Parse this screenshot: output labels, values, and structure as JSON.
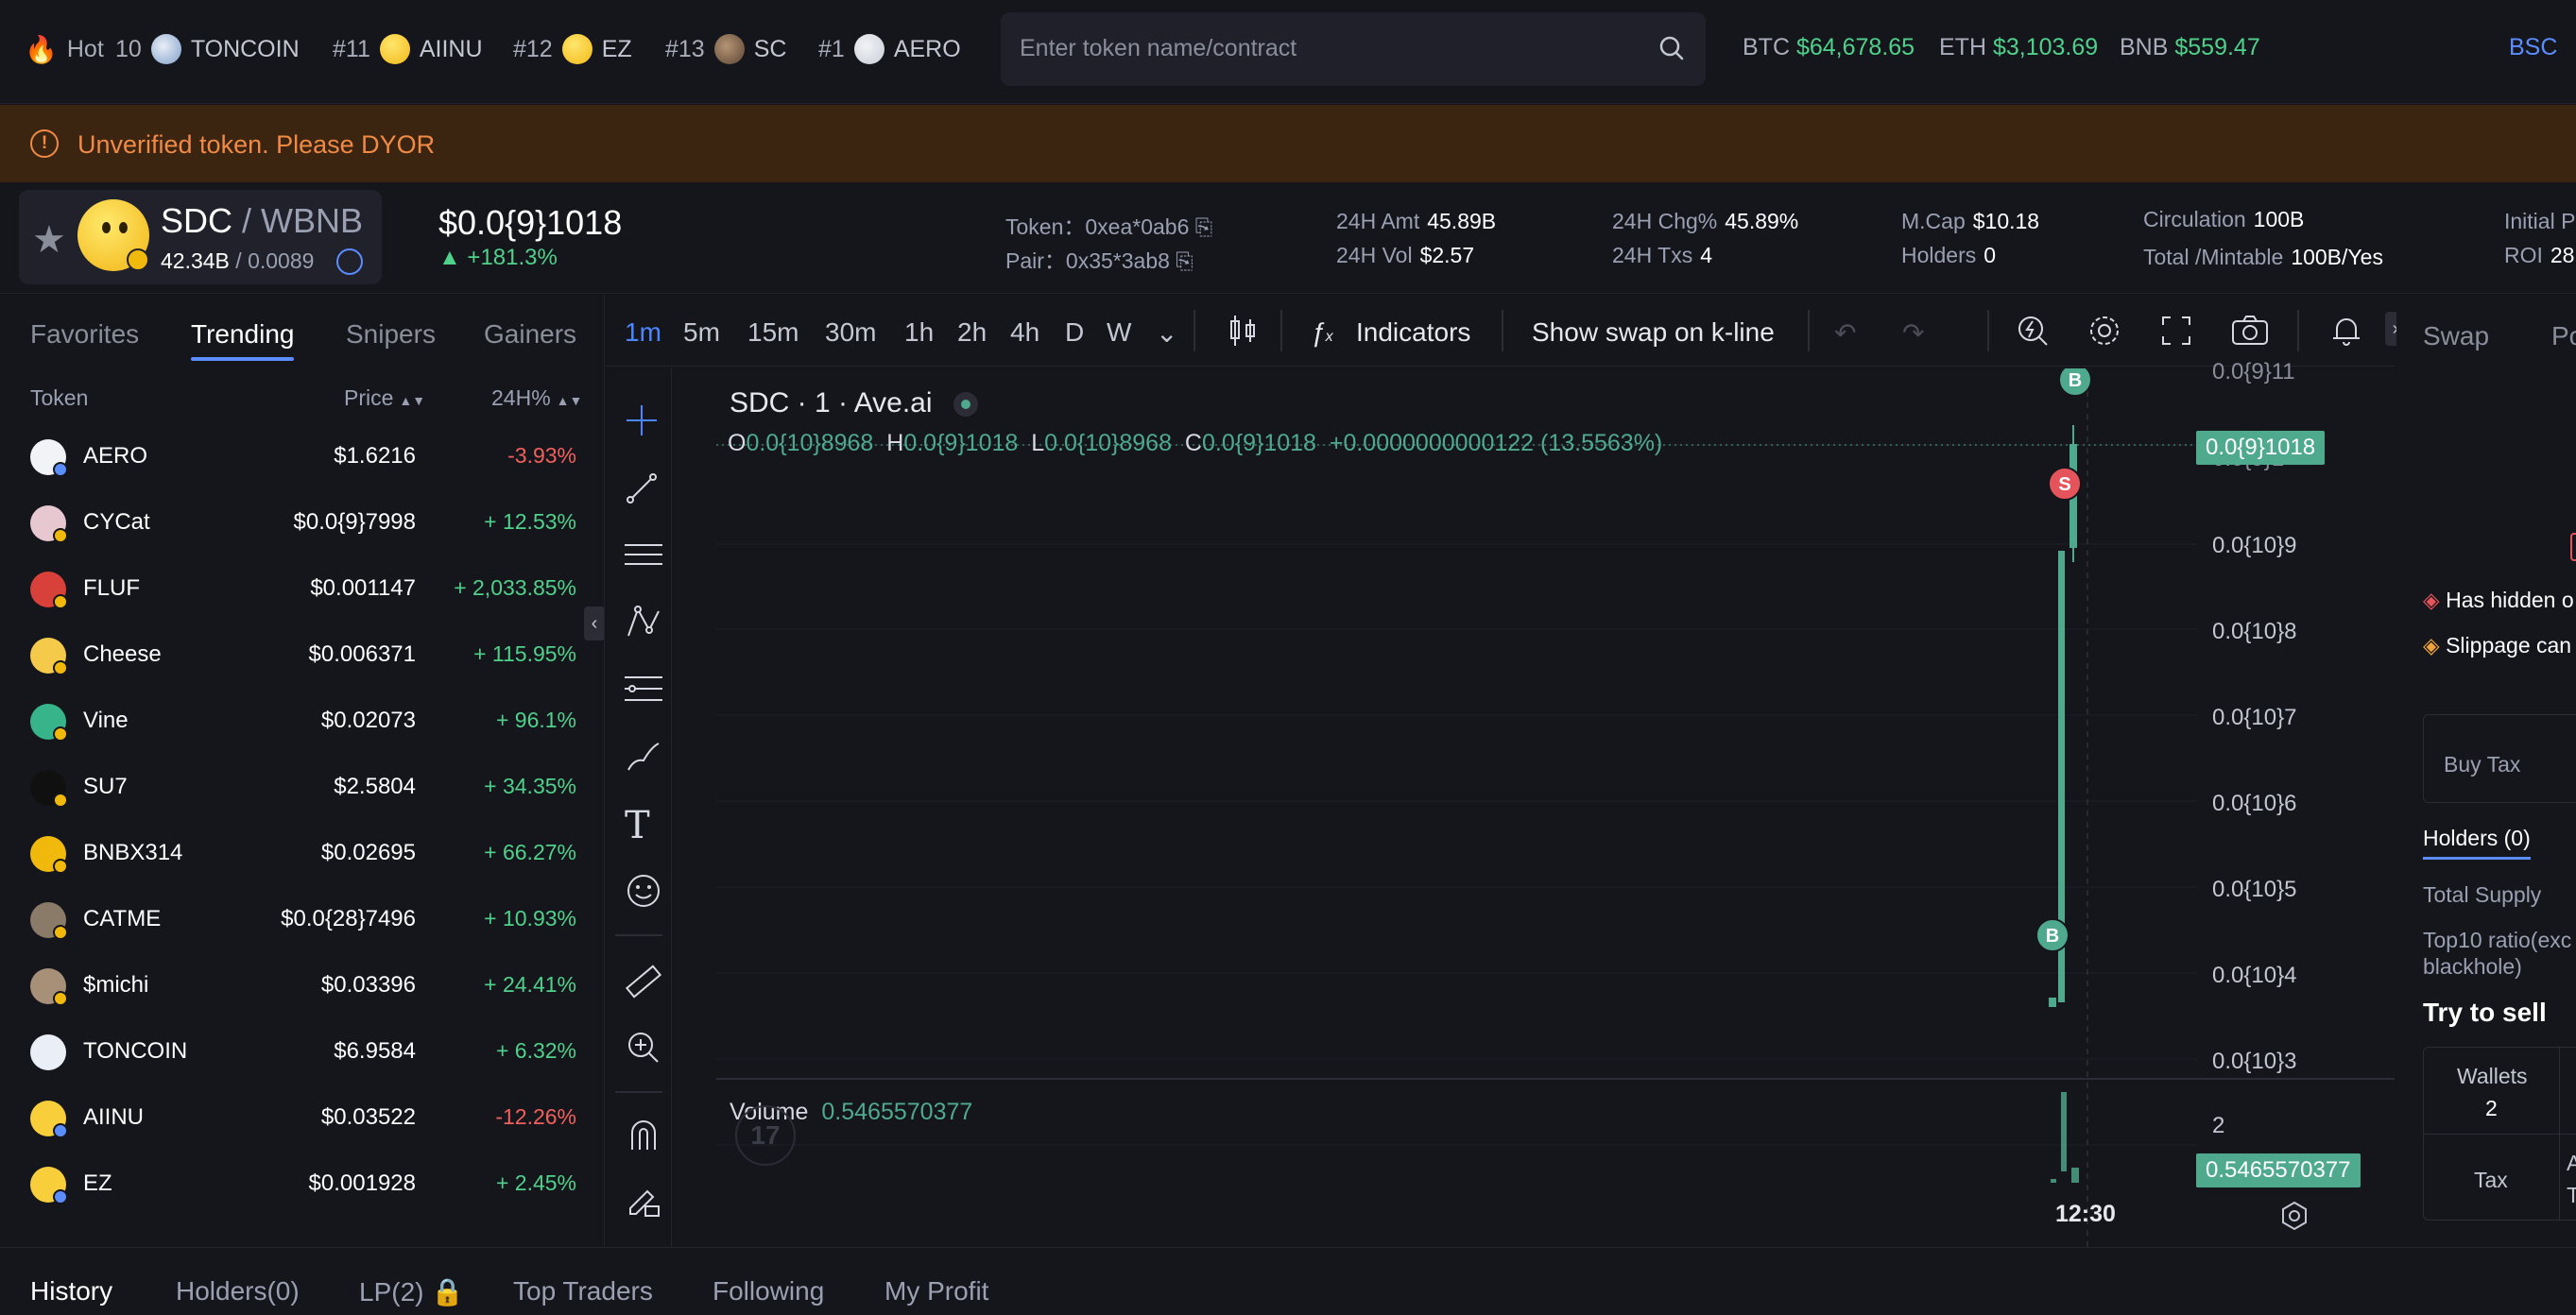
{
  "topbar": {
    "hot_label": "Hot",
    "tickers": [
      {
        "rank": "10",
        "name": "TONCOIN"
      },
      {
        "rank": "#11",
        "name": "AIINU"
      },
      {
        "rank": "#12",
        "name": "EZ"
      },
      {
        "rank": "#13",
        "name": "SC"
      },
      {
        "rank": "#1",
        "name": "AERO"
      }
    ],
    "search_placeholder": "Enter token name/contract",
    "prices": [
      {
        "sym": "BTC",
        "val": "$64,678.65"
      },
      {
        "sym": "ETH",
        "val": "$3,103.69"
      },
      {
        "sym": "BNB",
        "val": "$559.47"
      }
    ],
    "chain": "BSC"
  },
  "warning": {
    "text": "Unverified token. Please DYOR"
  },
  "token": {
    "base": "SDC",
    "sep": " / ",
    "quote": "WBNB",
    "supply": "42.34B",
    "supply_sep": " / ",
    "supply_quote": "0.0089",
    "price": "$0.0{9}1018",
    "change": "+181.3%",
    "stats": {
      "token_label": "Token：",
      "token_val": "0xea*0ab6",
      "pair_label": "Pair：",
      "pair_val": "0x35*3ab8",
      "amt_label": "24H Amt",
      "amt_val": "45.89B",
      "vol_label": "24H Vol",
      "vol_val": "$2.57",
      "chg_label": "24H Chg%",
      "chg_val": "45.89%",
      "txs_label": "24H Txs",
      "txs_val": "4",
      "mcap_label": "M.Cap",
      "mcap_val": "$10.18",
      "holders_label": "Holders",
      "holders_val": "0",
      "circ_label": "Circulation",
      "circ_val": "100B",
      "total_label": "Total /Mintable",
      "total_val": "100B/Yes",
      "initial_label": "Initial P",
      "roi_label": "ROI",
      "roi_val": "28"
    }
  },
  "left": {
    "tabs": [
      "Favorites",
      "Trending",
      "Snipers",
      "Gainers"
    ],
    "active_tab": 1,
    "headers": {
      "token": "Token",
      "price": "Price",
      "change": "24H%"
    },
    "rows": [
      {
        "name": "AERO",
        "price": "$1.6216",
        "change": "-3.93%",
        "dir": "dn",
        "color": "#f2f3f6",
        "badge": "bl"
      },
      {
        "name": "CYCat",
        "price": "$0.0{9}7998",
        "change": "+ 12.53%",
        "dir": "up",
        "color": "#e8c8d0",
        "badge": "y"
      },
      {
        "name": "FLUF",
        "price": "$0.001147",
        "change": "+ 2,033.85%",
        "dir": "up",
        "color": "#d8403a",
        "badge": "y"
      },
      {
        "name": "Cheese",
        "price": "$0.006371",
        "change": "+ 115.95%",
        "dir": "up",
        "color": "#f5c94a",
        "badge": "y"
      },
      {
        "name": "Vine",
        "price": "$0.02073",
        "change": "+ 96.1%",
        "dir": "up",
        "color": "#38b48a",
        "badge": "y"
      },
      {
        "name": "SU7",
        "price": "$2.5804",
        "change": "+ 34.35%",
        "dir": "up",
        "color": "#101010",
        "badge": "y"
      },
      {
        "name": "BNBX314",
        "price": "$0.02695",
        "change": "+ 66.27%",
        "dir": "up",
        "color": "#f0b90b",
        "badge": "y"
      },
      {
        "name": "CATME",
        "price": "$0.0{28}7496",
        "change": "+ 10.93%",
        "dir": "up",
        "color": "#8a7a68",
        "badge": "y"
      },
      {
        "name": "$michi",
        "price": "$0.03396",
        "change": "+ 24.41%",
        "dir": "up",
        "color": "#a89078",
        "badge": "y"
      },
      {
        "name": "TONCOIN",
        "price": "$6.9584",
        "change": "+ 6.32%",
        "dir": "up",
        "color": "#e9eef7",
        "badge": "none"
      },
      {
        "name": "AIINU",
        "price": "$0.03522",
        "change": "-12.26%",
        "dir": "dn",
        "color": "#f8cf3a",
        "badge": "bl"
      },
      {
        "name": "EZ",
        "price": "$0.001928",
        "change": "+ 2.45%",
        "dir": "up",
        "color": "#f8cf3a",
        "badge": "bl"
      }
    ]
  },
  "chart": {
    "timeframes": [
      "1m",
      "5m",
      "15m",
      "30m",
      "1h",
      "2h",
      "4h",
      "D",
      "W"
    ],
    "active_tf": 0,
    "indicators_label": "Indicators",
    "swap_label": "Show swap on k-line",
    "title": "SDC · 1 · Ave.ai",
    "ohlc": {
      "o_label": "O",
      "o": "0.0{10}8968",
      "h_label": "H",
      "h": "0.0{9}1018",
      "l_label": "L",
      "l": "0.0{10}8968",
      "c_label": "C",
      "c": "0.0{9}1018",
      "delta": "+0.0000000000122 (13.5563%)"
    },
    "y_ticks": [
      "0.0{10}9",
      "0.0{10}8",
      "0.0{10}7",
      "0.0{10}6",
      "0.0{10}5",
      "0.0{10}4",
      "0.0{10}3"
    ],
    "y_tick_top": "0.0{9}11",
    "y_tick_partial": "0.0{9}1",
    "price_tag": "0.0{9}1018",
    "volume_label": "Volume",
    "volume_val": "0.5465570377",
    "volume_tick": "2",
    "volume_tag": "0.5465570377",
    "time_label": "12:30",
    "markers": [
      {
        "text": "B"
      },
      {
        "text": "S"
      },
      {
        "text": "B"
      }
    ],
    "buy_color": "#4faa8d",
    "sell_color": "#e5545a",
    "candle_color": "#4faa8d"
  },
  "right": {
    "tab_swap": "Swap",
    "tab_partial": "Po",
    "risk1": "Has hidden o",
    "risk2": "Slippage can",
    "buy_tax": "Buy Tax",
    "holders_tab": "Holders (0)",
    "total_supply": "Total Supply",
    "top10_line1": "Top10 ratio(exc",
    "top10_line2": "blackhole)",
    "try_sell": "Try to sell",
    "wallets_label": "Wallets",
    "wallets_val": "2",
    "tax_label": "Tax",
    "col2_a": "A",
    "col2_b": "T"
  },
  "bottom": {
    "tabs": [
      "History",
      "Holders(0)",
      "LP(2)",
      "Top Traders",
      "Following",
      "My Profit"
    ],
    "active": 0
  }
}
